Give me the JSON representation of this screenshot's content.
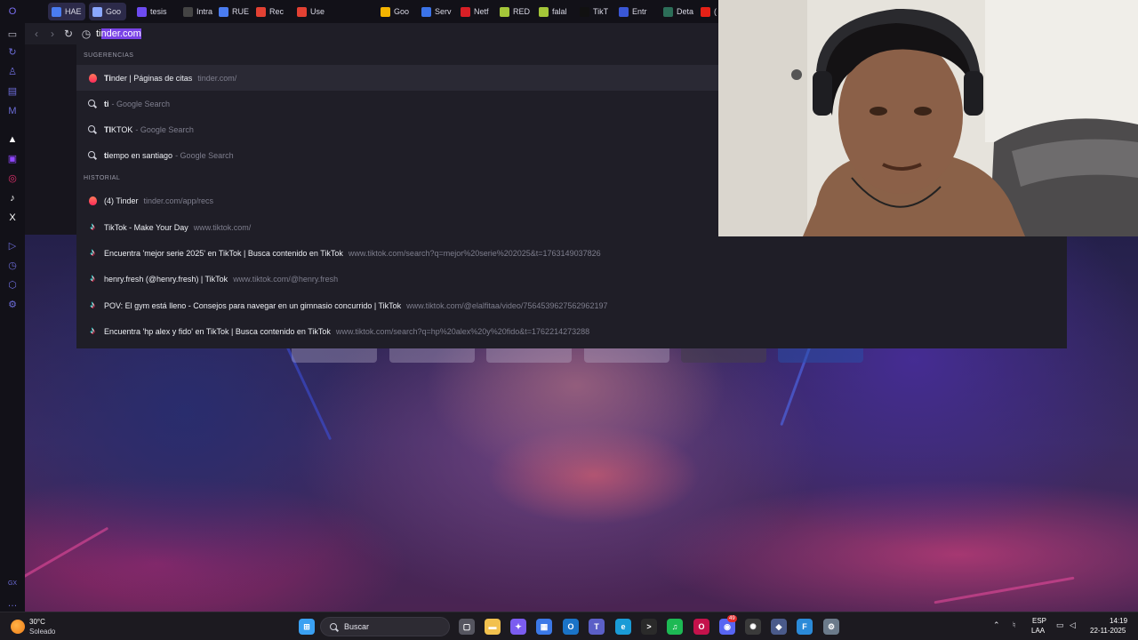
{
  "tabs": [
    {
      "label": "HAE",
      "icon": "docs-icon",
      "color": "#4a7cf0",
      "active": true
    },
    {
      "label": "Goo",
      "icon": "gemini-icon",
      "color": "#8aa7ff",
      "active": true
    },
    {
      "label": "tesis",
      "icon": "extension-icon",
      "color": "#6d4bf0",
      "active": false
    },
    {
      "label": "Intra",
      "icon": "intranet-icon",
      "color": "#444",
      "active": false
    },
    {
      "label": "RUE",
      "icon": "docs-icon",
      "color": "#4a7cf0",
      "active": false
    },
    {
      "label": "Rec",
      "icon": "gmail-icon",
      "color": "#e34133",
      "active": false
    },
    {
      "label": "Use",
      "icon": "gmail-icon",
      "color": "#e34133",
      "active": false
    },
    {
      "label": "Goo",
      "icon": "drive-icon",
      "color": "#f4b400",
      "active": false
    },
    {
      "label": "Serv",
      "icon": "service-icon",
      "color": "#3b73e8",
      "active": false
    },
    {
      "label": "Netf",
      "icon": "netflix-icon",
      "color": "#d81f26",
      "active": false
    },
    {
      "label": "RED",
      "icon": "red-icon",
      "color": "#a4c639",
      "active": false
    },
    {
      "label": "falal",
      "icon": "falabella-icon",
      "color": "#a4c639",
      "active": false
    },
    {
      "label": "TikT",
      "icon": "tiktok-icon",
      "color": "#111",
      "active": false
    },
    {
      "label": "Entr",
      "icon": "entra-icon",
      "color": "#3a57d6",
      "active": false
    },
    {
      "label": "Deta",
      "icon": "detail-icon",
      "color": "#2c6e58",
      "active": false
    },
    {
      "label": "(",
      "icon": "youtube-icon",
      "color": "#e62117",
      "active": false
    }
  ],
  "omnibox": {
    "typed": "ti",
    "completion": "nder.com"
  },
  "suggestions": {
    "header": "Sugerencias",
    "items": [
      {
        "bold": "Ti",
        "rest": "nder | Páginas de citas",
        "sub": "tinder.com/",
        "icon": "tinder-icon"
      },
      {
        "bold": "ti",
        "rest": "",
        "sub": "- Google Search",
        "icon": "search-icon"
      },
      {
        "bold": "TI",
        "rest": "KTOK",
        "sub": "- Google Search",
        "icon": "search-icon"
      },
      {
        "bold": "ti",
        "rest": "empo en santiago",
        "sub": "- Google Search",
        "icon": "search-icon"
      }
    ]
  },
  "history": {
    "header": "Historial",
    "items": [
      {
        "main": "(4) Tinder",
        "sub": "tinder.com/app/recs",
        "icon": "tinder-icon"
      },
      {
        "main": "TikTok - Make Your Day",
        "sub": "www.tiktok.com/",
        "icon": "tiktok-icon"
      },
      {
        "main": "Encuentra 'mejor serie 2025' en TikTok | Busca contenido en TikTok",
        "sub": "www.tiktok.com/search?q=mejor%20serie%202025&t=1763149037826",
        "icon": "tiktok-icon"
      },
      {
        "main": "henry.fresh (@henry.fresh) | TikTok",
        "sub": "www.tiktok.com/@henry.fresh",
        "icon": "tiktok-icon"
      },
      {
        "main": "POV: El gym está lleno - Consejos para navegar en un gimnasio concurrido | TikTok",
        "sub": "www.tiktok.com/@elalfitaa/video/7564539627562962197",
        "icon": "tiktok-icon"
      },
      {
        "main": "Encuentra 'hp alex y fido' en TikTok | Busca contenido en TikTok",
        "sub": "www.tiktok.com/search?q=hp%20alex%20y%20fido&t=1762214273288",
        "icon": "tiktok-icon"
      }
    ]
  },
  "sidebar": {
    "icons": [
      {
        "name": "opera-logo-icon",
        "glyph": "O",
        "color": "#7b6ff5"
      },
      {
        "name": "tabs-icon",
        "glyph": "▭",
        "color": "#bbbbc8"
      },
      {
        "name": "history-icon",
        "glyph": "↻",
        "color": "#6c6cd8"
      },
      {
        "name": "aria-icon",
        "glyph": "♙",
        "color": "#6c6cd8"
      },
      {
        "name": "workspace-icon",
        "glyph": "▤",
        "color": "#6c6cd8"
      },
      {
        "name": "gmail-side-icon",
        "glyph": "M",
        "color": "#6c6cd8"
      },
      {
        "name": "triangle-icon",
        "glyph": "▲",
        "color": "#ffffff"
      },
      {
        "name": "twitch-icon",
        "glyph": "▣",
        "color": "#9147ff"
      },
      {
        "name": "instagram-icon",
        "glyph": "◎",
        "color": "#e1306c"
      },
      {
        "name": "tiktok-side-icon",
        "glyph": "♪",
        "color": "#ffffff"
      },
      {
        "name": "x-icon",
        "glyph": "X",
        "color": "#ffffff"
      },
      {
        "name": "player-icon",
        "glyph": "▷",
        "color": "#6c6cd8"
      },
      {
        "name": "clock-icon",
        "glyph": "◷",
        "color": "#6c6cd8"
      },
      {
        "name": "cube-icon",
        "glyph": "⬡",
        "color": "#6c6cd8"
      },
      {
        "name": "settings-icon",
        "glyph": "⚙",
        "color": "#6c6cd8"
      },
      {
        "name": "gx-icon",
        "glyph": "GX",
        "color": "#6c6cd8"
      },
      {
        "name": "more-icon",
        "glyph": "…",
        "color": "#6c6cd8"
      }
    ]
  },
  "taskbar": {
    "weather_temp": "30°C",
    "weather_condition": "Soleado",
    "search_placeholder": "Buscar",
    "lang_line1": "ESP",
    "lang_line2": "LAA",
    "time": "14:19",
    "date": "22-11-2025",
    "apps": [
      {
        "name": "start-button",
        "glyph": "⊞",
        "color": "#3aa0f2"
      },
      {
        "name": "task-view-icon",
        "glyph": "▢",
        "color": "#55555f"
      },
      {
        "name": "file-explorer-icon",
        "glyph": "▬",
        "color": "#f2c14e"
      },
      {
        "name": "copilot-icon",
        "glyph": "✦",
        "color": "#7b5cf0"
      },
      {
        "name": "store-icon",
        "glyph": "▦",
        "color": "#3b78e7"
      },
      {
        "name": "outlook-icon",
        "glyph": "O",
        "color": "#1a73c7"
      },
      {
        "name": "teams-icon",
        "glyph": "T",
        "color": "#5b5fc7"
      },
      {
        "name": "edge-icon",
        "glyph": "e",
        "color": "#1a9bd6"
      },
      {
        "name": "terminal-icon",
        "glyph": ">",
        "color": "#2a2a2a"
      },
      {
        "name": "spotify-icon",
        "glyph": "♫",
        "color": "#1db954"
      },
      {
        "name": "opera-gx-icon",
        "glyph": "O",
        "color": "#c4124b"
      },
      {
        "name": "discord-icon",
        "glyph": "◉",
        "color": "#5865f2"
      },
      {
        "name": "chatgpt-icon",
        "glyph": "✺",
        "color": "#3a3a3a"
      },
      {
        "name": "vpn-icon",
        "glyph": "◆",
        "color": "#4a5a8a"
      },
      {
        "name": "word-like-icon",
        "glyph": "F",
        "color": "#2b8ad8"
      },
      {
        "name": "settings-app-icon",
        "glyph": "⚙",
        "color": "#6b7a8a"
      }
    ],
    "discord_badge": "49"
  }
}
